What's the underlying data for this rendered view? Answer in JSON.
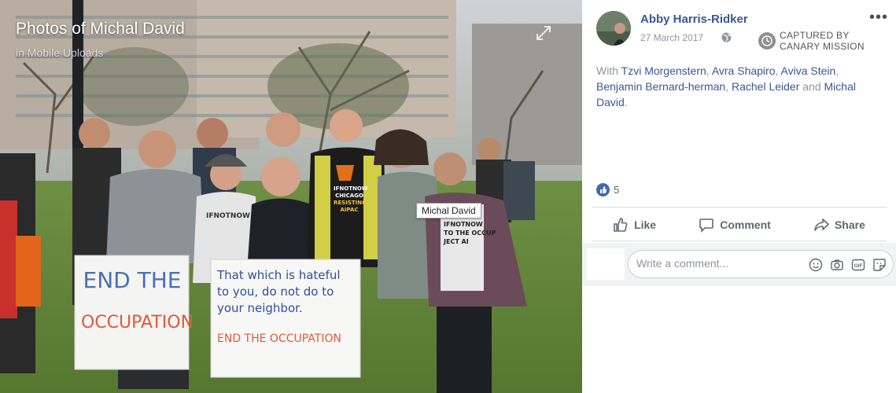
{
  "photo": {
    "title": "Photos of Michal David",
    "album": "in Mobile Uploads",
    "tag_tooltip": "Michal David",
    "sign_left": {
      "line1": "END THE",
      "line2": "OCCUPATION"
    },
    "sign_right": {
      "line1": "That which is hateful",
      "line2": "to you, do not do to",
      "line3": "your neighbor.",
      "line4": "END THE OCCUPATION"
    },
    "shirt_left": "IFNOTNOW",
    "shirt_center": {
      "line1": "IFNOTNOW",
      "line2": "CHICAGO",
      "line3": "RESISTING",
      "line4": "AIPAC"
    },
    "shirt_right": {
      "line1": "IFNOTNOW",
      "line2": "TO THE OCCUP",
      "line3": "JECT AI"
    }
  },
  "post": {
    "author": "Abby Harris-Ridker",
    "date": "27 March 2017",
    "stamp_line1": "CAPTURED BY",
    "stamp_line2": "CANARY MISSION",
    "with_prefix": "With",
    "tagged": [
      "Tzvi Morgenstern",
      "Avra Shapiro",
      "Aviva Stein",
      "Benjamin Bernard-herman",
      "Rachel Leider"
    ],
    "and_word": "and",
    "last_tagged": "Michal David",
    "like_count": "5",
    "actions": {
      "like": "Like",
      "comment": "Comment",
      "share": "Share"
    },
    "comment_placeholder": "Write a comment..."
  },
  "colors": {
    "link": "#365899",
    "muted": "#90949c",
    "like_blue": "#4267b2"
  },
  "icons": [
    "expand-icon",
    "globe-icon",
    "more-icon",
    "clock-icon",
    "like-badge-icon",
    "thumb-icon",
    "comment-icon",
    "share-icon",
    "emoji-icon",
    "camera-icon",
    "gif-icon",
    "sticker-icon"
  ]
}
